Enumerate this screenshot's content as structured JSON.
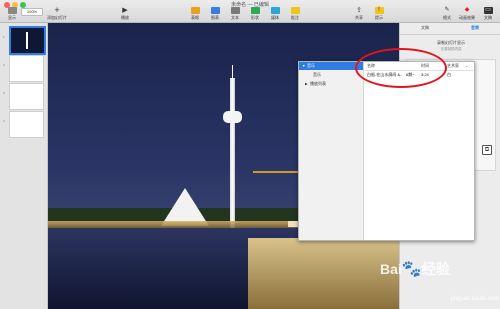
{
  "window": {
    "title": "未命名 — 已编辑",
    "traffic_colors": [
      "#fc605c",
      "#fdbc40",
      "#34c84a"
    ]
  },
  "toolbar": {
    "left": [
      {
        "label": "显示",
        "icon": "view-icon"
      },
      {
        "label": "缩放",
        "value": "100%"
      },
      {
        "label": "添加幻灯片",
        "icon": "add-slide-icon",
        "glyph": "+"
      }
    ],
    "center_play": {
      "label": "播放",
      "icon": "play-icon",
      "glyph": "▶"
    },
    "insert": [
      {
        "label": "表格",
        "icon": "table-icon",
        "color": "#e8a21e"
      },
      {
        "label": "图表",
        "icon": "chart-icon",
        "color": "#3a7de0"
      },
      {
        "label": "文本",
        "icon": "text-icon",
        "color": "#7a7a7a"
      },
      {
        "label": "形状",
        "icon": "shape-icon",
        "color": "#30a85a"
      },
      {
        "label": "媒体",
        "icon": "media-icon",
        "color": "#2aa7d8"
      },
      {
        "label": "批注",
        "icon": "comment-icon",
        "color": "#f0c419"
      }
    ],
    "share": {
      "label": "共享",
      "icon": "share-icon",
      "glyph": "⇪"
    },
    "tips": {
      "label": "提示",
      "icon": "tips-icon",
      "glyph": "!",
      "color": "#f0c419"
    },
    "right": [
      {
        "label": "格式",
        "icon": "format-icon",
        "glyph": "✎"
      },
      {
        "label": "动画效果",
        "icon": "animate-icon",
        "glyph": "◆",
        "color": "#d22"
      },
      {
        "label": "文稿",
        "icon": "document-icon",
        "glyph": "▭"
      }
    ]
  },
  "navigator": {
    "slides": [
      {
        "num": "1",
        "selected": true
      },
      {
        "num": "2",
        "selected": false
      },
      {
        "num": "3",
        "selected": false
      },
      {
        "num": "4",
        "selected": false
      }
    ]
  },
  "inspector": {
    "tabs": [
      "文稿",
      "音频"
    ],
    "active_tab": "音频",
    "record_title": "录制幻灯片显示",
    "record_sub": "无录制的内容",
    "corner_glyph": "⧉"
  },
  "popup": {
    "sidebar": [
      {
        "label": "音乐",
        "arrow": "▼",
        "selected": true
      },
      {
        "label": "音乐",
        "arrow": "",
        "selected": false
      },
      {
        "label": "播放列表",
        "arrow": "▶",
        "selected": false
      }
    ],
    "header": {
      "name": "名称",
      "time": "时间",
      "artist": "艺术家"
    },
    "row": {
      "name": "白船-在山水屏间 &...",
      "extra": "6期~",
      "time": "3:24",
      "artist": "白"
    }
  },
  "watermark": {
    "text": "Bai",
    "paw": "🐾",
    "suffix": "经验",
    "domain": "jingyan.baidu.com"
  },
  "annotation_color": "#e3141c"
}
